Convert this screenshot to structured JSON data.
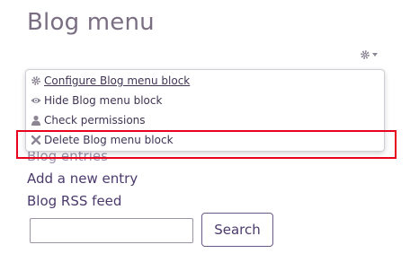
{
  "block": {
    "title": "Blog menu",
    "actions_icon": "gear-icon"
  },
  "menu": {
    "items": [
      {
        "label": "Configure Blog menu block",
        "icon": "gear-icon"
      },
      {
        "label": "Hide Blog menu block",
        "icon": "eye-icon"
      },
      {
        "label": "Check permissions",
        "icon": "user-icon"
      },
      {
        "label": "Delete Blog menu block",
        "icon": "close-icon"
      }
    ]
  },
  "links": {
    "blog_entries": "Blog entries",
    "add_entry": "Add a new entry",
    "rss_feed": "Blog RSS feed"
  },
  "search": {
    "button_label": "Search",
    "input_value": ""
  },
  "colors": {
    "accent": "#4b3a6b",
    "highlight": "#e8001c"
  }
}
